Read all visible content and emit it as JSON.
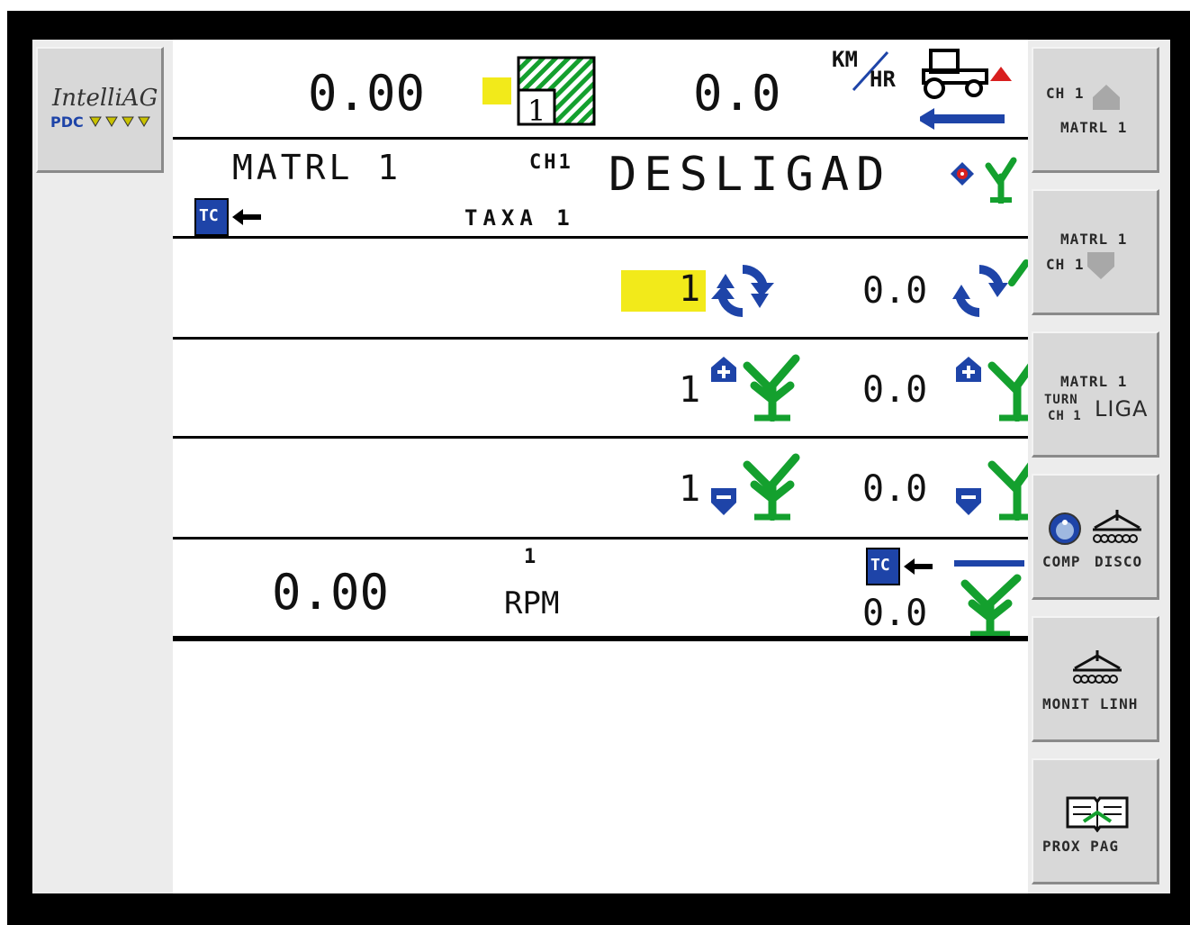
{
  "brand": {
    "name": "IntelliAG",
    "sub": "PDC"
  },
  "header": {
    "area_value": "0.00",
    "area_icon": "field-area-icon",
    "area_section": "1",
    "speed_value": "0.0",
    "speed_unit_top": "KM",
    "speed_unit_bottom": "HR"
  },
  "material_row": {
    "name": "MATRL 1",
    "channel": "CH1",
    "status": "DESLIGAD",
    "rate_label": "TAXA 1",
    "tc_badge": "TC"
  },
  "rows": [
    {
      "id": "rate-row",
      "target": "1",
      "actual": "0.0"
    },
    {
      "id": "increase-row",
      "target": "1",
      "actual": "0.0"
    },
    {
      "id": "decrease-row",
      "target": "1",
      "actual": "0.0"
    }
  ],
  "rpm_row": {
    "value": "0.00",
    "index": "1",
    "unit": "RPM",
    "tc_badge": "TC",
    "actual": "0.0"
  },
  "softkeys": [
    {
      "line1": "CH 1",
      "line2": "MATRL 1"
    },
    {
      "line1": "MATRL 1",
      "line2": "CH 1"
    },
    {
      "line1": "MATRL 1",
      "line2": "TURN",
      "line3": "CH 1",
      "line4": "LIGA"
    },
    {
      "line1": "COMP",
      "line2": "DISCO"
    },
    {
      "line1": "MONIT LINH"
    },
    {
      "line1": "PROX PAG"
    }
  ],
  "colors": {
    "accent_blue": "#1e44a8",
    "plant_green": "#14a02e",
    "highlight_yellow": "#f2ea1a",
    "warning_red": "#d81f1f"
  }
}
